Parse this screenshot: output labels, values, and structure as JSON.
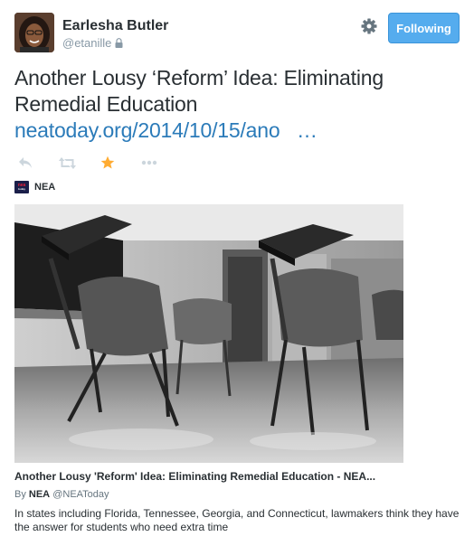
{
  "author": {
    "name": "Earlesha Butler",
    "handle": "@etanille"
  },
  "follow_button": {
    "label": "Following"
  },
  "tweet": {
    "text": "Another Lousy ‘Reform’ Idea: Eliminating Remedial Education ",
    "link_text": "neatoday.org/2014/10/15/ano",
    "link_ellipsis": "…"
  },
  "actions": {
    "reply_icon": "reply-icon",
    "retweet_icon": "retweet-icon",
    "favorite_icon": "star-icon",
    "more_icon": "more-icon",
    "favorite_color": "#ffac33",
    "inactive_color": "#ccd6dd"
  },
  "source": {
    "name": "NEA",
    "logo_text_top": "nea",
    "logo_text_bottom": "today"
  },
  "card": {
    "title": "Another Lousy 'Reform' Idea: Eliminating Remedial Education - NEA...",
    "by_prefix": "By",
    "by_name": "NEA",
    "by_handle": "@NEAToday",
    "description": "In states including Florida, Tennessee, Georgia, and Connecticut, lawmakers think they have the answer for students who need extra time"
  },
  "colors": {
    "link": "#2b7bb9",
    "follow_bg": "#55acee",
    "text": "#292f33",
    "muted": "#8899a6"
  }
}
